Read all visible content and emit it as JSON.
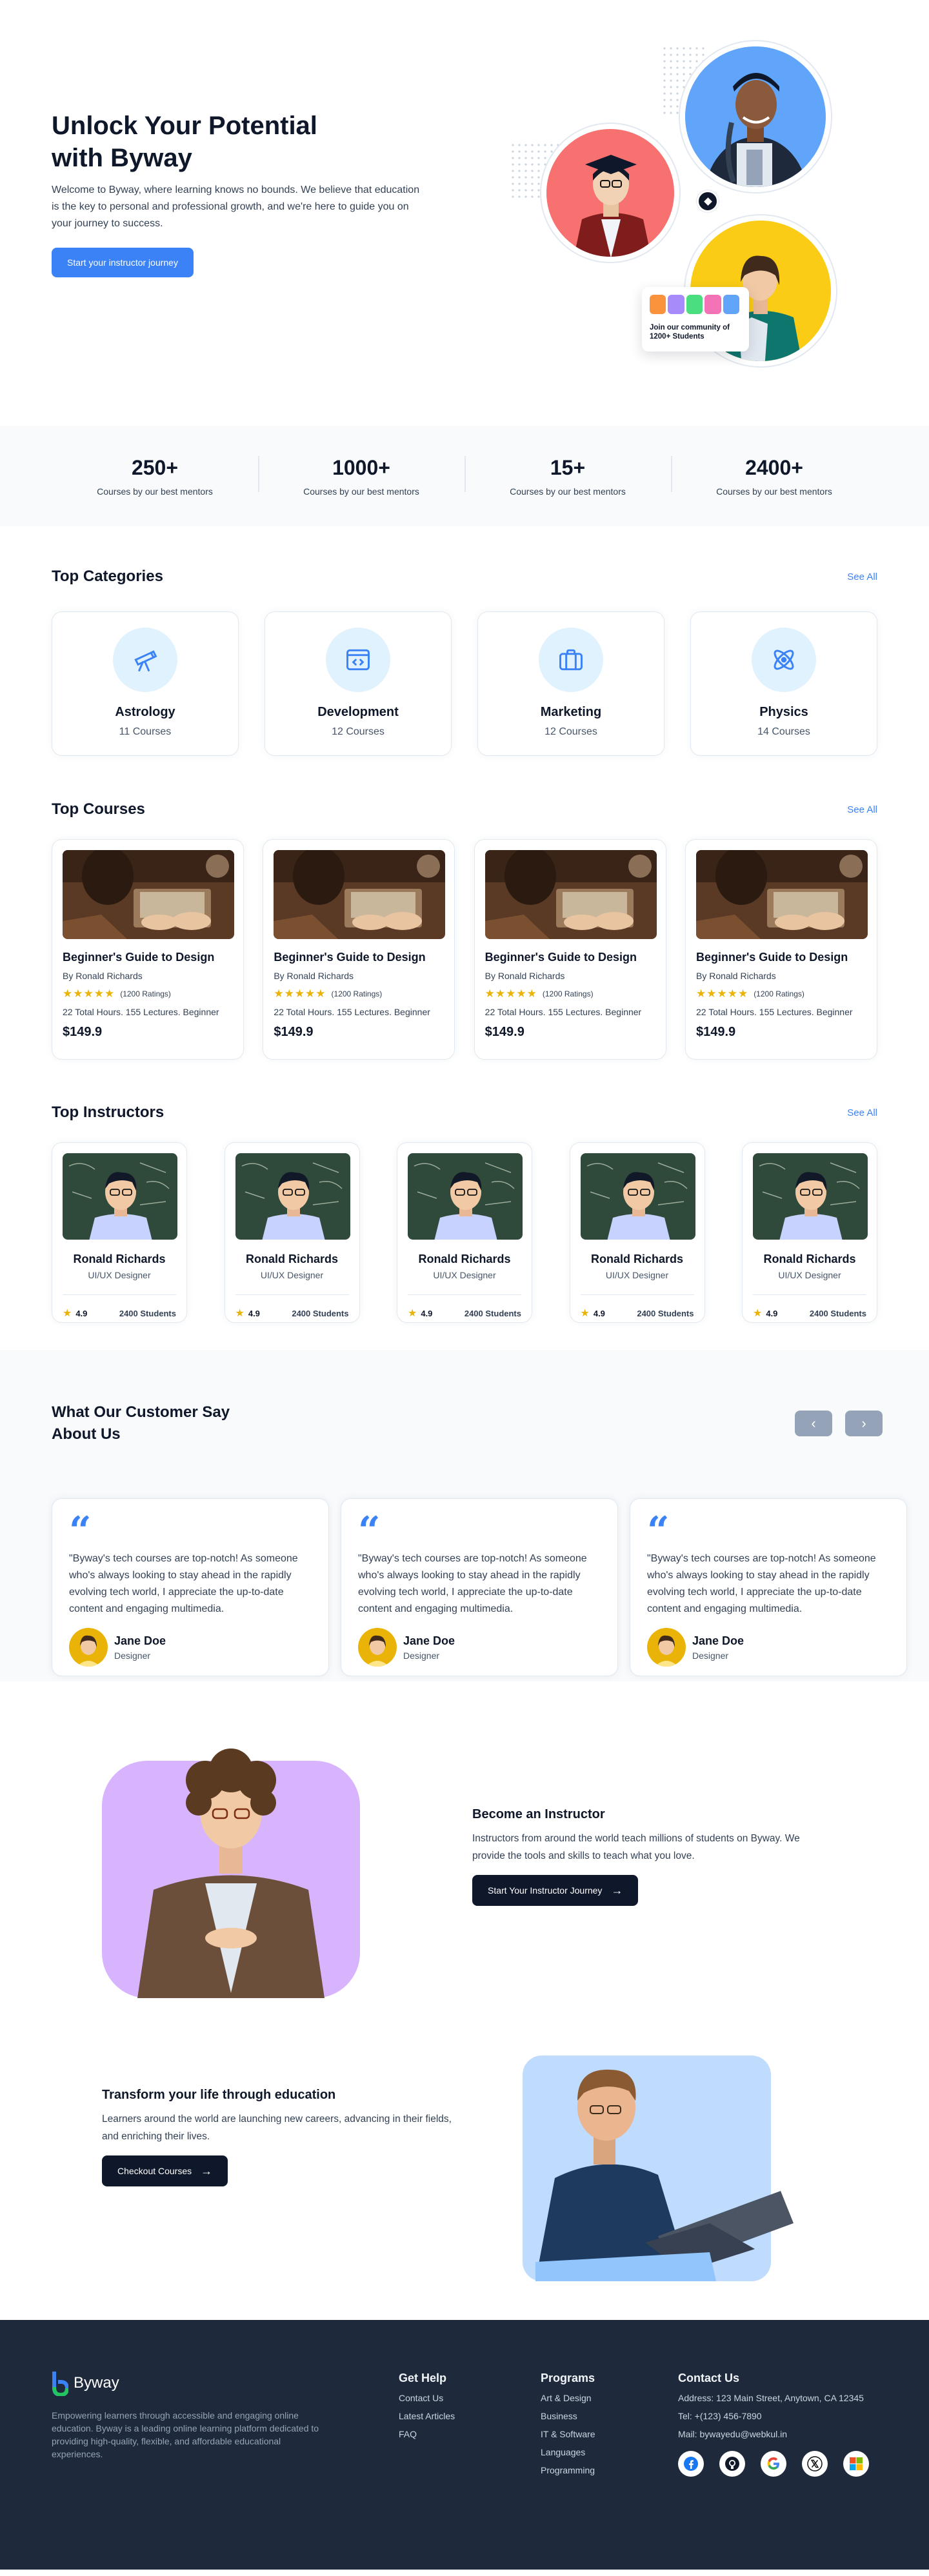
{
  "hero": {
    "title": "Unlock Your Potential with Byway",
    "description": "Welcome to Byway, where learning knows no bounds. We believe that education is the key to personal and professional growth, and we're here to guide you on your journey to success.",
    "cta_label": "Start your instructor journey",
    "community_text": "Join our community of 1200+ Students"
  },
  "stats": [
    {
      "number": "250+",
      "label": "Courses by our best mentors"
    },
    {
      "number": "1000+",
      "label": "Courses by our best mentors"
    },
    {
      "number": "15+",
      "label": "Courses by our best mentors"
    },
    {
      "number": "2400+",
      "label": "Courses by our best mentors"
    }
  ],
  "categories": {
    "title": "Top Categories",
    "see_all": "See All",
    "items": [
      {
        "name": "Astrology",
        "count": "11 Courses",
        "icon": "telescope-icon"
      },
      {
        "name": "Development",
        "count": "12 Courses",
        "icon": "code-window-icon"
      },
      {
        "name": "Marketing",
        "count": "12 Courses",
        "icon": "briefcase-icon"
      },
      {
        "name": "Physics",
        "count": "14 Courses",
        "icon": "atom-icon"
      }
    ]
  },
  "courses": {
    "title": "Top Courses",
    "see_all": "See All",
    "items": [
      {
        "title": "Beginner's Guide to Design",
        "author": "By Ronald Richards",
        "stars": "★★★★★",
        "ratings": "(1200 Ratings)",
        "meta": "22 Total Hours. 155 Lectures. Beginner",
        "price": "$149.9"
      },
      {
        "title": "Beginner's Guide to Design",
        "author": "By Ronald Richards",
        "stars": "★★★★★",
        "ratings": "(1200 Ratings)",
        "meta": "22 Total Hours. 155 Lectures. Beginner",
        "price": "$149.9"
      },
      {
        "title": "Beginner's Guide to Design",
        "author": "By Ronald Richards",
        "stars": "★★★★★",
        "ratings": "(1200 Ratings)",
        "meta": "22 Total Hours. 155 Lectures. Beginner",
        "price": "$149.9"
      },
      {
        "title": "Beginner's Guide to Design",
        "author": "By Ronald Richards",
        "stars": "★★★★★",
        "ratings": "(1200 Ratings)",
        "meta": "22 Total Hours. 155 Lectures. Beginner",
        "price": "$149.9"
      }
    ]
  },
  "instructors": {
    "title": "Top Instructors",
    "see_all": "See All",
    "items": [
      {
        "name": "Ronald Richards",
        "role": "UI/UX Designer",
        "rating": "4.9",
        "students": "2400 Students"
      },
      {
        "name": "Ronald Richards",
        "role": "UI/UX Designer",
        "rating": "4.9",
        "students": "2400 Students"
      },
      {
        "name": "Ronald Richards",
        "role": "UI/UX Designer",
        "rating": "4.9",
        "students": "2400 Students"
      },
      {
        "name": "Ronald Richards",
        "role": "UI/UX Designer",
        "rating": "4.9",
        "students": "2400 Students"
      },
      {
        "name": "Ronald Richards",
        "role": "UI/UX Designer",
        "rating": "4.9",
        "students": "2400 Students"
      }
    ]
  },
  "testimonials": {
    "title": "What Our Customer Say About Us",
    "prev_icon": "chevron-left-icon",
    "next_icon": "chevron-right-icon",
    "items": [
      {
        "quote": "\"Byway's tech courses are top-notch! As someone who's always looking to stay ahead in the rapidly evolving tech world, I appreciate the up-to-date content and engaging multimedia.",
        "name": "Jane Doe",
        "role": "Designer"
      },
      {
        "quote": "\"Byway's tech courses are top-notch! As someone who's always looking to stay ahead in the rapidly evolving tech world, I appreciate the up-to-date content and engaging multimedia.",
        "name": "Jane Doe",
        "role": "Designer"
      },
      {
        "quote": "\"Byway's tech courses are top-notch! As someone who's always looking to stay ahead in the rapidly evolving tech world, I appreciate the up-to-date content and engaging multimedia.",
        "name": "Jane Doe",
        "role": "Designer"
      }
    ]
  },
  "become_instructor": {
    "title": "Become an Instructor",
    "description": "Instructors from around the world teach millions of students on Byway. We provide the tools and skills to teach what you love.",
    "cta_label": "Start Your Instructor Journey"
  },
  "transform": {
    "title": "Transform your life through education",
    "description": "Learners around the world are launching new careers, advancing in their fields, and enriching their lives.",
    "cta_label": "Checkout Courses"
  },
  "footer": {
    "brand": "Byway",
    "description": "Empowering learners through accessible and engaging online education. Byway is a leading online learning platform dedicated to providing high-quality, flexible, and affordable educational experiences.",
    "help": {
      "title": "Get Help",
      "links": [
        "Contact Us",
        "Latest Articles",
        "FAQ"
      ]
    },
    "programs": {
      "title": "Programs",
      "links": [
        "Art & Design",
        "Business",
        "IT & Software",
        "Languages",
        "Programming"
      ]
    },
    "contact": {
      "title": "Contact Us",
      "address": "Address: 123 Main Street, Anytown, CA 12345",
      "tel": "Tel: +(123) 456-7890",
      "mail": "Mail: bywayedu@webkul.in"
    },
    "socials": [
      "facebook-icon",
      "github-icon",
      "google-icon",
      "x-icon",
      "microsoft-icon"
    ]
  },
  "colors": {
    "accent": "#3b82f6",
    "dark": "#0f172a",
    "footer_bg": "#1e293b",
    "star": "#eab308",
    "hero_red": "#f87171",
    "hero_blue": "#60a5fa",
    "hero_yellow": "#facc15",
    "instructor_purple": "#d8b4fe",
    "transform_blue": "#bfdbfe"
  }
}
